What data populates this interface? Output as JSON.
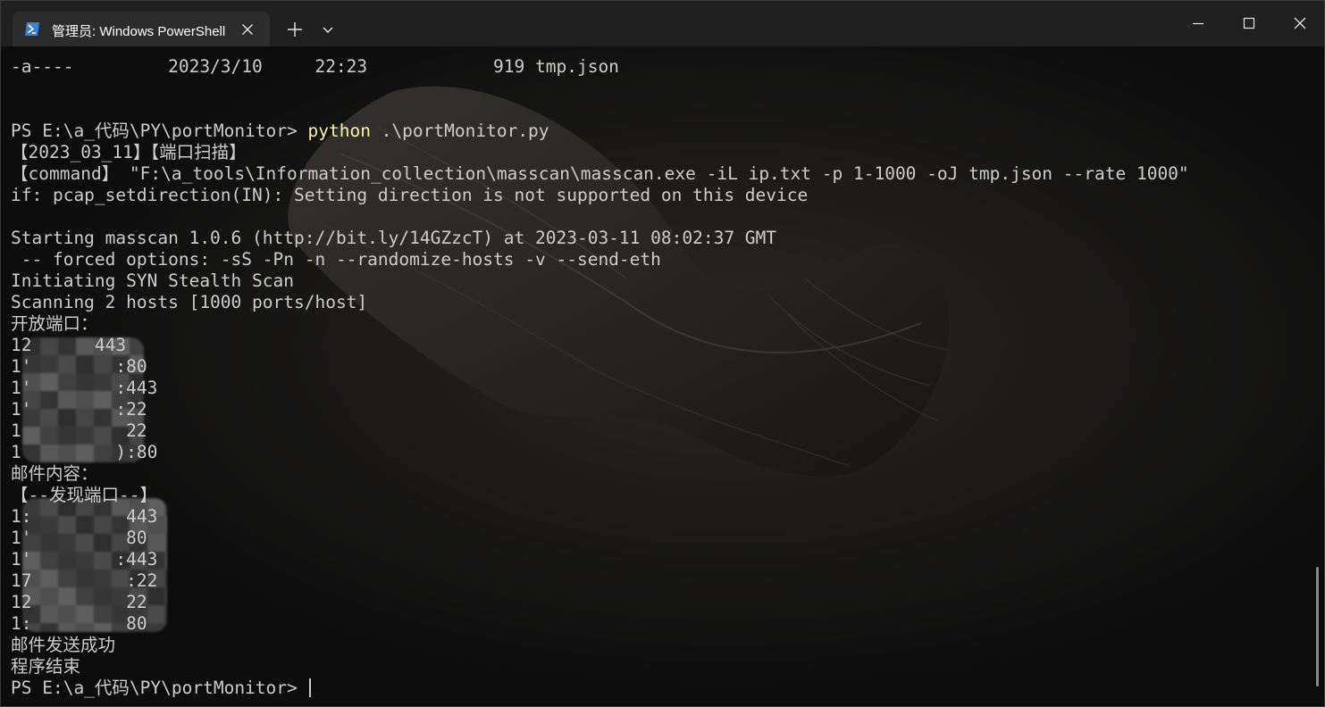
{
  "window": {
    "tab_title": "管理员: Windows PowerShell",
    "tab_icon": "powershell-icon",
    "controls": [
      "minimize-icon",
      "maximize-icon",
      "close-icon"
    ]
  },
  "terminal": {
    "lines": [
      "-a----         2023/3/10     22:23            919 tmp.json",
      "",
      "",
      "PS E:\\a_代码\\PY\\portMonitor> ",
      "【2023_03_11】【端口扫描】",
      "【command】 \"F:\\a_tools\\Information_collection\\masscan\\masscan.exe -iL ip.txt -p 1-1000 -oJ tmp.json --rate 1000\"",
      "if: pcap_setdirection(IN): Setting direction is not supported on this device",
      "",
      "Starting masscan 1.0.6 (http://bit.ly/14GZzcT) at 2023-03-11 08:02:37 GMT",
      " -- forced options: -sS -Pn -n --randomize-hosts -v --send-eth",
      "Initiating SYN Stealth Scan",
      "Scanning 2 hosts [1000 ports/host]",
      "开放端口：",
      "12      443",
      "1'        :80",
      "1'        :443",
      "1'        :22",
      "1          22",
      "1         ):80",
      "邮件内容：",
      "【--发现端口--】",
      "1:         443",
      "1'         80",
      "1'        :443",
      "17         :22",
      "12         22",
      "1:         80",
      "邮件发送成功",
      "程序结束",
      "PS E:\\a_代码\\PY\\portMonitor> "
    ],
    "command_prefix": "PS E:\\a_代码\\PY\\portMonitor> ",
    "command": "python",
    "command_args": " .\\portMonitor.py",
    "prompt_final": "PS E:\\a_代码\\PY\\portMonitor> "
  },
  "colors": {
    "background": "#0c0c0c",
    "text": "#cccccc",
    "command": "#f9f1a5",
    "titlebar": "#202020",
    "tab": "#2c2c2c"
  }
}
